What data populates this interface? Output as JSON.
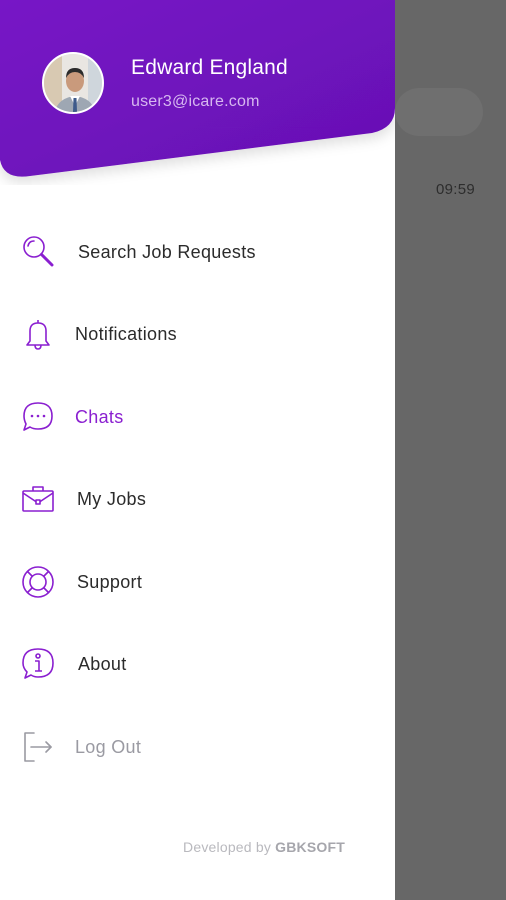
{
  "user": {
    "name": "Edward England",
    "email": "user3@icare.com"
  },
  "background": {
    "time": "09:59"
  },
  "menu": {
    "items": [
      {
        "label": "Search Job Requests",
        "icon": "search-icon"
      },
      {
        "label": "Notifications",
        "icon": "bell-icon"
      },
      {
        "label": "Chats",
        "icon": "chat-icon",
        "active": true
      },
      {
        "label": "My Jobs",
        "icon": "briefcase-icon"
      },
      {
        "label": "Support",
        "icon": "lifebuoy-icon"
      },
      {
        "label": "About",
        "icon": "info-icon"
      },
      {
        "label": "Log Out",
        "icon": "logout-icon",
        "muted": true
      }
    ]
  },
  "footer": {
    "prefix": "Developed by ",
    "brand": "GBKSOFT"
  },
  "colors": {
    "accent": "#8a1fd0",
    "header_gradient_start": "#7414c4",
    "header_gradient_end": "#6a0fb5",
    "overlay": "#676767"
  }
}
